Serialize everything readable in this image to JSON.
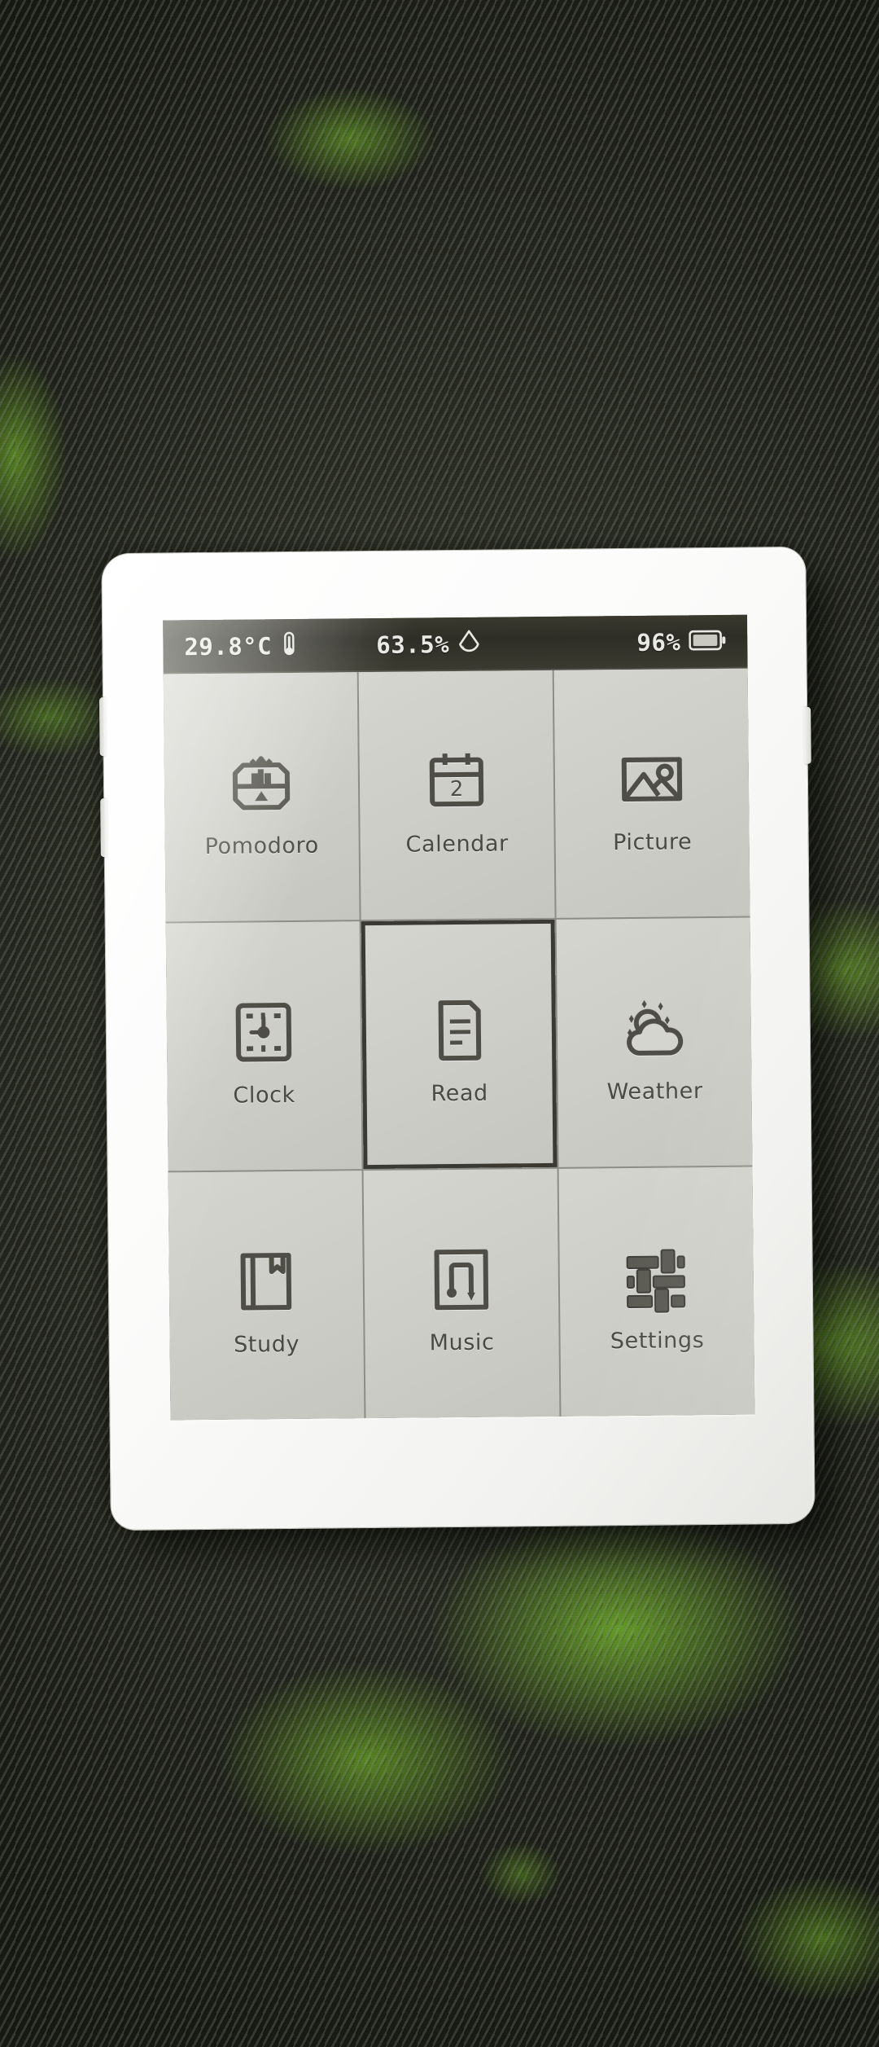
{
  "device": {
    "kind": "e-ink-handheld",
    "body_color": "#ffffff",
    "screen_color": "#cfcfc9"
  },
  "statusbar": {
    "background": "#33332b",
    "text_color": "#e9e9e3",
    "temperature": "29.8°C",
    "temperature_icon": "thermometer-icon",
    "humidity": "63.5%",
    "humidity_icon": "humidity-droplet-icon",
    "battery": "96%",
    "battery_icon": "battery-icon"
  },
  "grid": {
    "columns": 3,
    "rows": 3,
    "selected": "Read",
    "tiles": [
      {
        "label": "Pomodoro",
        "icon": "pomodoro-timer-icon",
        "selected": false
      },
      {
        "label": "Calendar",
        "icon": "calendar-icon",
        "selected": false,
        "badge": "2"
      },
      {
        "label": "Picture",
        "icon": "picture-image-icon",
        "selected": false
      },
      {
        "label": "Clock",
        "icon": "clock-icon",
        "selected": false
      },
      {
        "label": "Read",
        "icon": "document-read-icon",
        "selected": true
      },
      {
        "label": "Weather",
        "icon": "sun-cloud-icon",
        "selected": false
      },
      {
        "label": "Study",
        "icon": "book-bookmark-icon",
        "selected": false
      },
      {
        "label": "Music",
        "icon": "music-note-icon",
        "selected": false
      },
      {
        "label": "Settings",
        "icon": "sliders-icon",
        "selected": false
      }
    ]
  },
  "buttons": {
    "left_upper": "side-button-up",
    "left_lower": "side-button-down",
    "right_upper": "side-button-right"
  }
}
